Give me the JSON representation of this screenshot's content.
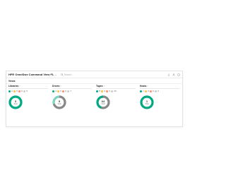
{
  "app": {
    "title": "HPE OmniSwx Command View FL",
    "search_placeholder": "Search",
    "section": "Views"
  },
  "colors": {
    "green": "#01a982",
    "gray": "#888888",
    "track": "#e0e0e0"
  },
  "panels": [
    {
      "title": "Libraries",
      "legend": [
        "2",
        "0",
        "0",
        "5"
      ],
      "value": "3",
      "sub": "Total",
      "segments": [
        {
          "color": "#01a982",
          "fraction": 1.0
        }
      ]
    },
    {
      "title": "Drives",
      "legend": [
        "4",
        "0",
        "0",
        "7"
      ],
      "value": "5",
      "sub": "Total",
      "segments": [
        {
          "color": "#888888",
          "fraction": 0.7
        },
        {
          "color": "#7fd4c1",
          "fraction": 0.3
        }
      ]
    },
    {
      "title": "Tapes",
      "legend": [
        "8",
        "0",
        "0",
        "20"
      ],
      "value": "64",
      "sub": "Total",
      "segments": [
        {
          "color": "#888888",
          "fraction": 0.55
        },
        {
          "color": "#01a982",
          "fraction": 0.45
        }
      ]
    },
    {
      "title": "Hosts",
      "legend": [
        "1",
        "0",
        "0",
        "0"
      ],
      "value": "1",
      "sub": "Total",
      "segments": [
        {
          "color": "#01a982",
          "fraction": 1.0
        }
      ]
    }
  ]
}
